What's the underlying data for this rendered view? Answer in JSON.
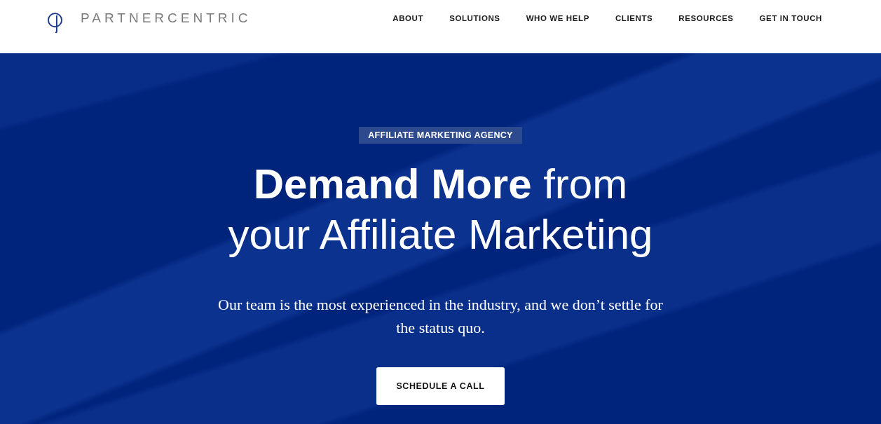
{
  "header": {
    "brand": "PARTNERCENTRIC",
    "nav": [
      "ABOUT",
      "SOLUTIONS",
      "WHO WE HELP",
      "CLIENTS",
      "RESOURCES",
      "GET IN TOUCH"
    ]
  },
  "hero": {
    "badge": "AFFILIATE MARKETING AGENCY",
    "heading": "**Demand More** from your Affiliate Marketing",
    "subtitle": "Our team is the most experienced in the industry, and we don’t settle for the status quo.",
    "cta": "SCHEDULE A CALL"
  }
}
